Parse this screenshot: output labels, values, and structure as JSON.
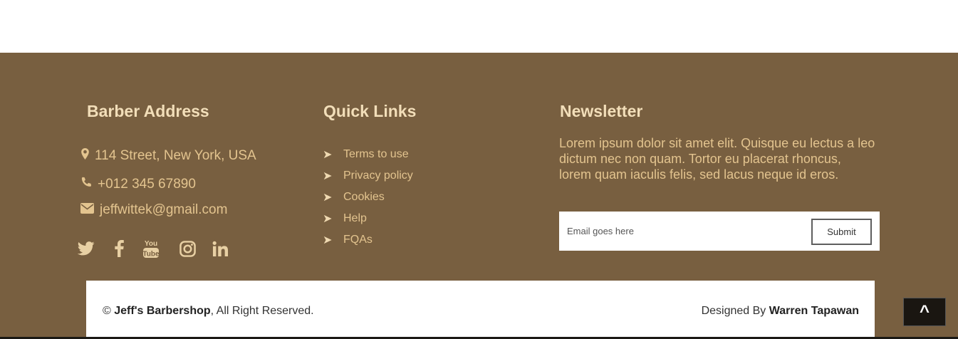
{
  "address_col": {
    "title": "Barber Address",
    "street": "114 Street, New York, USA",
    "phone": "+012 345 67890",
    "email": "jeffwittek@gmail.com",
    "social_icons": [
      "twitter-icon",
      "facebook-icon",
      "youtube-icon",
      "instagram-icon",
      "linkedin-icon"
    ]
  },
  "links_col": {
    "title": "Quick Links",
    "arrow": "➤",
    "items": [
      {
        "label": "Terms to use"
      },
      {
        "label": "Privacy policy"
      },
      {
        "label": "Cookies"
      },
      {
        "label": "Help"
      },
      {
        "label": "FQAs"
      }
    ]
  },
  "newsletter_col": {
    "title": "Newsletter",
    "text": "Lorem ipsum dolor sit amet elit. Quisque eu lectus a leo dictum nec non quam. Tortor eu placerat rhoncus, lorem quam iaculis felis, sed lacus neque id eros.",
    "email_placeholder": "Email goes here",
    "email_value": "",
    "submit_label": "Submit"
  },
  "copyright": {
    "symbol": "©",
    "brand": "Jeff's Barbershop",
    "rest": ", All Right Reserved.",
    "designed_prefix": "Designed By",
    "designer": "Warren Tapawan"
  },
  "back_to_top": {
    "label": "^"
  },
  "colors": {
    "footer_bg": "#785f40",
    "title": "#f2deb9",
    "text": "#e3c48f",
    "back_to_top_bg": "#1a1611"
  }
}
